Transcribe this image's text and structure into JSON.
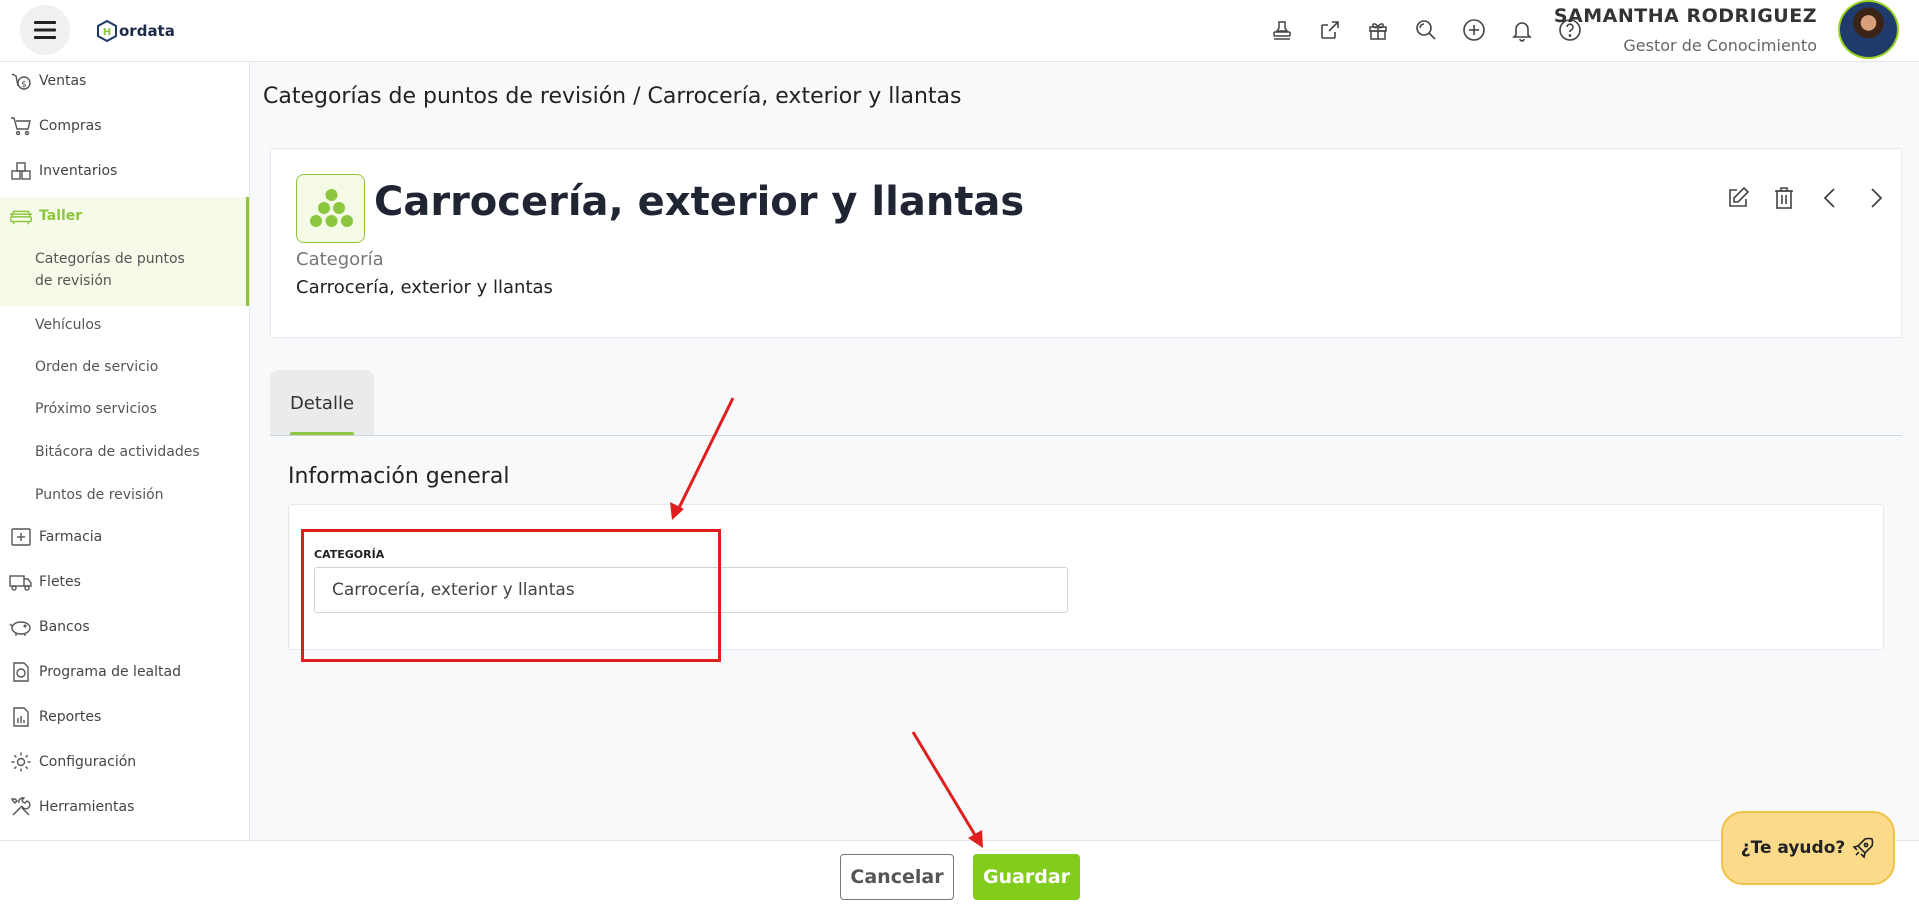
{
  "header": {
    "logo_text": "ordata",
    "user_name": "SAMANTHA RODRIGUEZ",
    "user_role": "Gestor de Conocimiento",
    "icons": [
      "stamp-icon",
      "external-link-icon",
      "gift-icon",
      "search-zoom-icon",
      "add-circle-icon",
      "bell-icon",
      "help-circle-icon"
    ]
  },
  "sidebar": {
    "items": [
      {
        "label": "Ventas",
        "icon": "sales-icon"
      },
      {
        "label": "Compras",
        "icon": "cart-icon"
      },
      {
        "label": "Inventarios",
        "icon": "inventory-icon"
      },
      {
        "label": "Taller",
        "icon": "car-icon"
      },
      {
        "label": "Farmacia",
        "icon": "pharmacy-icon"
      },
      {
        "label": "Fletes",
        "icon": "truck-icon"
      },
      {
        "label": "Bancos",
        "icon": "piggy-bank-icon"
      },
      {
        "label": "Programa de lealtad",
        "icon": "loyalty-icon"
      },
      {
        "label": "Reportes",
        "icon": "report-icon"
      },
      {
        "label": "Configuración",
        "icon": "gear-icon"
      },
      {
        "label": "Herramientas",
        "icon": "tools-icon"
      }
    ],
    "subitems": [
      {
        "label_1": "Categorías de puntos",
        "label_2": "de revisión"
      },
      {
        "label": "Vehículos"
      },
      {
        "label": "Orden de servicio"
      },
      {
        "label": "Próximo servicios"
      },
      {
        "label": "Bitácora de actividades"
      },
      {
        "label": "Puntos de revisión"
      }
    ]
  },
  "main": {
    "breadcrumb": "Categorías de puntos de revisión /  Carrocería, exterior y llantas",
    "title": "Carrocería, exterior y llantas",
    "category_label": "Categoría",
    "category_value": "Carrocería, exterior y llantas",
    "tab_label": "Detalle",
    "section_title": "Información general",
    "field_label": "CATEGORÍA",
    "field_value": "Carrocería, exterior y llantas"
  },
  "footer": {
    "cancel_label": "Cancelar",
    "save_label": "Guardar",
    "help_label": "¿Te ayudo?"
  },
  "colors": {
    "accent": "#8cc63f",
    "save_button": "#82cc1c",
    "annotation": "#e01e1e",
    "help_button": "#fbdb8a"
  }
}
